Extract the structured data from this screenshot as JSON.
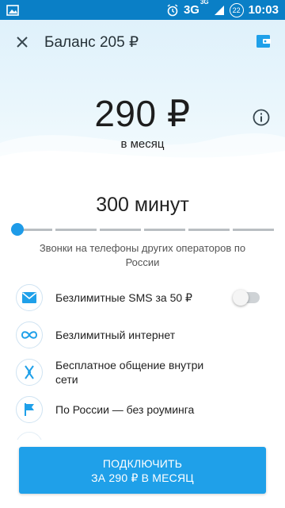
{
  "status_bar": {
    "network": "3G",
    "network_sup": "3G",
    "battery_level": "22",
    "time": "10:03",
    "icons": [
      "image-icon",
      "alarm-icon",
      "signal-icon",
      "battery-icon"
    ]
  },
  "header": {
    "title": "Баланс 205 ₽",
    "price": "290 ₽",
    "period": "в месяц",
    "icons": [
      "close-icon",
      "wallet-icon",
      "info-icon"
    ]
  },
  "minutes": {
    "title": "300 минут",
    "description": "Звонки на телефоны других операторов по России",
    "slider_position": 0
  },
  "features": [
    {
      "label": "Безлимитные SMS за 50 ₽",
      "icon": "envelope-icon",
      "toggle": false
    },
    {
      "label": "Безлимитный интернет",
      "icon": "infinity-icon"
    },
    {
      "label": "Бесплатное общение внутри сети",
      "icon": "call-within-network-icon"
    },
    {
      "label": "По России — без роуминга",
      "icon": "flag-icon"
    }
  ],
  "connect_button": {
    "line1": "ПОДКЛЮЧИТЬ",
    "line2": "ЗА 290 ₽ В МЕСЯЦ"
  },
  "colors": {
    "status_bar": "#0a7fc6",
    "accent": "#1fa0e9",
    "header_bg": "#dff1fb"
  }
}
